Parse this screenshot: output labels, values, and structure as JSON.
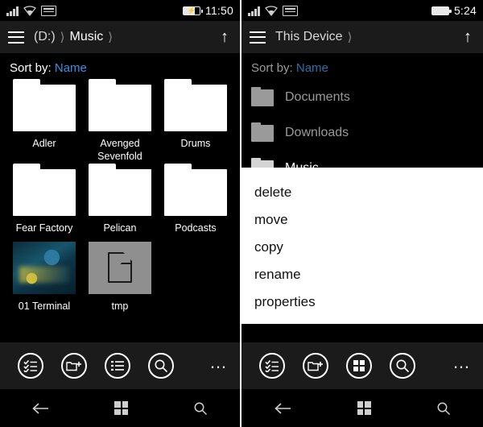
{
  "left": {
    "status": {
      "signal_icon": "signal-bars-icon",
      "wifi_icon": "wifi-icon",
      "sim_icon": "sim-card-icon",
      "battery_icon": "battery-charging-icon",
      "clock": "11:50"
    },
    "appbar": {
      "menu_icon": "hamburger-menu-icon",
      "crumb1": "(D:)",
      "crumb2": "Music",
      "up_icon": "up-arrow-icon"
    },
    "sort": {
      "label": "Sort by:",
      "value": "Name"
    },
    "items": [
      {
        "name": "Adler",
        "type": "folder"
      },
      {
        "name": "Avenged Sevenfold",
        "type": "folder"
      },
      {
        "name": "Drums",
        "type": "folder"
      },
      {
        "name": "Fear Factory",
        "type": "folder"
      },
      {
        "name": "Pelican",
        "type": "folder"
      },
      {
        "name": "Podcasts",
        "type": "folder"
      },
      {
        "name": "01 Terminal",
        "type": "image"
      },
      {
        "name": "tmp",
        "type": "file"
      }
    ],
    "commands": [
      {
        "icon": "select-checklist-icon",
        "label": "select"
      },
      {
        "icon": "new-folder-icon",
        "label": "new folder"
      },
      {
        "icon": "list-view-icon",
        "label": "view"
      },
      {
        "icon": "search-icon",
        "label": "search"
      }
    ],
    "more_icon": "ellipsis-icon",
    "nav": {
      "back_icon": "back-arrow-icon",
      "start_icon": "windows-start-icon",
      "search_icon": "search-icon"
    }
  },
  "right": {
    "status": {
      "signal_icon": "signal-bars-icon",
      "wifi_icon": "wifi-icon",
      "sim_icon": "sim-card-icon",
      "battery_icon": "battery-icon",
      "clock": "5:24"
    },
    "appbar": {
      "menu_icon": "hamburger-menu-icon",
      "crumb1": "This Device",
      "up_icon": "up-arrow-icon"
    },
    "sort": {
      "label": "Sort by:",
      "value": "Name"
    },
    "items": [
      {
        "name": "Documents",
        "selected": false
      },
      {
        "name": "Downloads",
        "selected": false
      },
      {
        "name": "Music",
        "selected": true
      }
    ],
    "context_menu": [
      "delete",
      "move",
      "copy",
      "rename",
      "properties"
    ],
    "commands": [
      {
        "icon": "select-checklist-icon",
        "label": "select"
      },
      {
        "icon": "new-folder-icon",
        "label": "new folder"
      },
      {
        "icon": "tile-view-icon",
        "label": "view"
      },
      {
        "icon": "search-icon",
        "label": "search"
      }
    ],
    "more_icon": "ellipsis-icon",
    "nav": {
      "back_icon": "back-arrow-icon",
      "start_icon": "windows-start-icon",
      "search_icon": "search-icon"
    }
  }
}
